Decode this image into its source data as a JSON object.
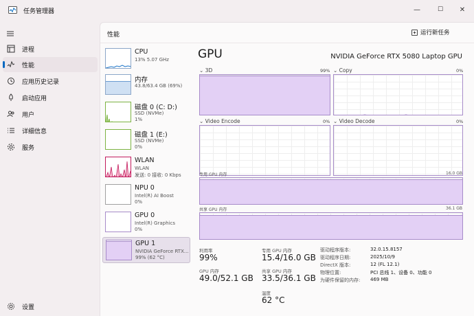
{
  "window": {
    "title": "任务管理器",
    "minimize": "—",
    "maximize": "☐",
    "close": "✕"
  },
  "nav": {
    "items": [
      {
        "label": "进程",
        "icon": "processes-icon"
      },
      {
        "label": "性能",
        "icon": "performance-icon",
        "active": true
      },
      {
        "label": "应用历史记录",
        "icon": "history-icon"
      },
      {
        "label": "启动应用",
        "icon": "startup-icon"
      },
      {
        "label": "用户",
        "icon": "users-icon"
      },
      {
        "label": "详细信息",
        "icon": "details-icon"
      },
      {
        "label": "服务",
        "icon": "services-icon"
      }
    ],
    "settings": "设置"
  },
  "header": {
    "title": "性能",
    "run_task": "运行新任务"
  },
  "devices": [
    {
      "name": "CPU",
      "sub1": "13% 5.07 GHz",
      "sub2": ""
    },
    {
      "name": "内存",
      "sub1": "43.8/63.4 GB (69%)",
      "sub2": ""
    },
    {
      "name": "磁盘 0 (C: D:)",
      "sub1": "SSD (NVMe)",
      "sub2": "1%"
    },
    {
      "name": "磁盘 1 (E:)",
      "sub1": "SSD (NVMe)",
      "sub2": "0%"
    },
    {
      "name": "WLAN",
      "sub1": "WLAN",
      "sub2": "发送: 0 接收: 0 Kbps"
    },
    {
      "name": "NPU 0",
      "sub1": "Intel(R) AI Boost",
      "sub2": "0%"
    },
    {
      "name": "GPU 0",
      "sub1": "Intel(R) Graphics",
      "sub2": "0%"
    },
    {
      "name": "GPU 1",
      "sub1": "NVIDIA GeForce RTX...",
      "sub2": "99% (62 °C)",
      "active": true
    }
  ],
  "gpu": {
    "title": "GPU",
    "model": "NVIDIA GeForce RTX 5080 Laptop GPU",
    "engines": [
      {
        "name": "3D",
        "pct": "99%",
        "usage": 0.99
      },
      {
        "name": "Copy",
        "pct": "0%",
        "usage": 0.0
      },
      {
        "name": "Video Encode",
        "pct": "0%",
        "usage": 0.0
      },
      {
        "name": "Video Decode",
        "pct": "0%",
        "usage": 0.0
      }
    ],
    "dedicated_mem": {
      "label": "专用 GPU 内存",
      "max": "16.0 GB",
      "usage": 0.96
    },
    "shared_mem": {
      "label": "共享 GPU 内存",
      "max": "36.1 GB",
      "usage": 0.93
    },
    "stats": {
      "utilization_label": "利用率",
      "utilization": "99%",
      "gpu_mem_label": "GPU 内存",
      "gpu_mem": "49.0/52.1 GB",
      "dedicated_label": "专用 GPU 内存",
      "dedicated": "15.4/16.0 GB",
      "shared_label": "共享 GPU 内存",
      "shared": "33.5/36.1 GB",
      "temp_label": "温度",
      "temp": "62 °C"
    },
    "info": {
      "driver_version_k": "驱动程序版本:",
      "driver_version_v": "32.0.15.8157",
      "driver_date_k": "驱动程序日期:",
      "driver_date_v": "2025/10/9",
      "directx_k": "DirectX 版本:",
      "directx_v": "12 (FL 12.1)",
      "location_k": "物理位置:",
      "location_v": "PCI 总线 1、设备 0、功能 0",
      "reserved_k": "为硬件保留的内存:",
      "reserved_v": "469 MB"
    }
  },
  "colors": {
    "gpu_fill": "#e3d0f5",
    "gpu_border": "#a78bc9",
    "accent": "#0067c0"
  }
}
